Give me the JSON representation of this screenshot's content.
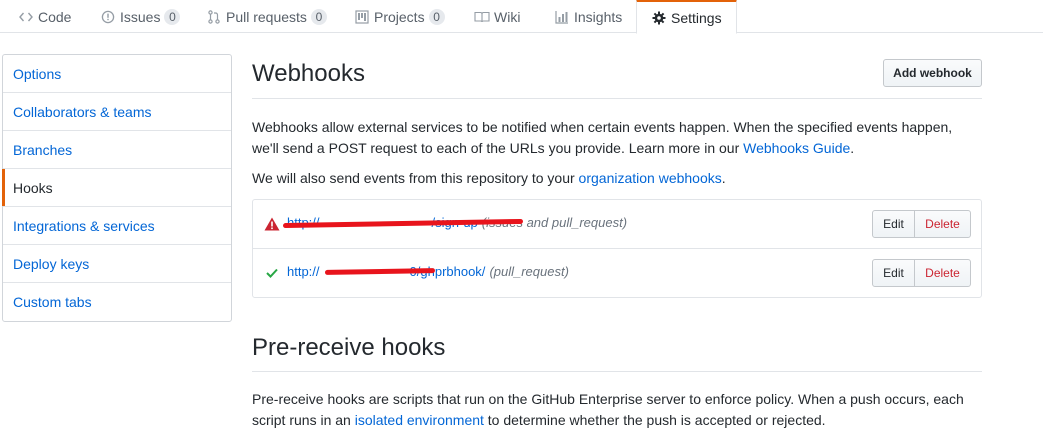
{
  "tabs": [
    {
      "label": "Code",
      "icon": "code-icon"
    },
    {
      "label": "Issues",
      "icon": "issue-icon",
      "count": "0"
    },
    {
      "label": "Pull requests",
      "icon": "pull-request-icon",
      "count": "0"
    },
    {
      "label": "Projects",
      "icon": "project-icon",
      "count": "0"
    },
    {
      "label": "Wiki",
      "icon": "book-icon"
    },
    {
      "label": "Insights",
      "icon": "graph-icon"
    },
    {
      "label": "Settings",
      "icon": "gear-icon",
      "selected": true
    }
  ],
  "sidebar": {
    "items": [
      {
        "label": "Options"
      },
      {
        "label": "Collaborators & teams"
      },
      {
        "label": "Branches"
      },
      {
        "label": "Hooks",
        "selected": true
      },
      {
        "label": "Integrations & services"
      },
      {
        "label": "Deploy keys"
      },
      {
        "label": "Custom tabs"
      }
    ]
  },
  "webhooks": {
    "title": "Webhooks",
    "add_button": "Add webhook",
    "description_pre": "Webhooks allow external services to be notified when certain events happen. When the specified events happen, we'll send a POST request to each of the URLs you provide. Learn more in our ",
    "description_link": "Webhooks Guide",
    "description_post": ".",
    "org_pre": "We will also send events from this repository to your ",
    "org_link": "organization webhooks",
    "org_post": ".",
    "hooks": [
      {
        "status": "error",
        "url_start": "http://",
        "url_end": "/sign-up",
        "events": "(issues and pull_request)",
        "edit": "Edit",
        "delete": "Delete"
      },
      {
        "status": "success",
        "url_start": "http://",
        "url_end": "0/ghprbhook/",
        "events": "(pull_request)",
        "edit": "Edit",
        "delete": "Delete"
      }
    ]
  },
  "prereceive": {
    "title": "Pre-receive hooks",
    "text_pre": "Pre-receive hooks are scripts that run on the GitHub Enterprise server to enforce policy. When a push occurs, each script runs in an ",
    "text_link": "isolated environment",
    "text_post": " to determine whether the push is accepted or rejected."
  },
  "colors": {
    "accent": "#e36209",
    "link": "#0366d6",
    "danger": "#cb2431",
    "success": "#28a745"
  }
}
